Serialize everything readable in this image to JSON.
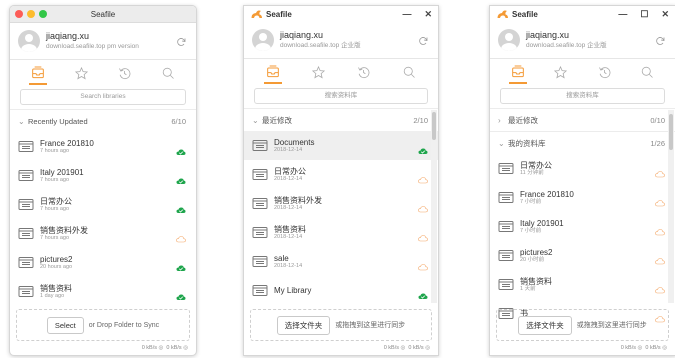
{
  "colors": {
    "accent": "#f49a35",
    "synced": "#1ea54c",
    "pending": "#f4a869"
  },
  "windows": [
    {
      "title": "Seafile",
      "user": "jiaqiang.xu",
      "server": "download.seafile.top",
      "server_suffix": "pm version",
      "search_placeholder": "Search libraries",
      "sections": [
        {
          "label": "Recently Updated",
          "count": "6/10",
          "expanded": true
        }
      ],
      "items": [
        {
          "name": "France 201810",
          "time": "7 hours ago",
          "status": "synced"
        },
        {
          "name": "Italy 201901",
          "time": "7 hours ago",
          "status": "synced"
        },
        {
          "name": "日常办公",
          "time": "7 hours ago",
          "status": "synced"
        },
        {
          "name": "销售资料外发",
          "time": "7 hours ago",
          "status": "pending"
        },
        {
          "name": "pictures2",
          "time": "20 hours ago",
          "status": "synced"
        },
        {
          "name": "销售资料",
          "time": "1 day ago",
          "status": "synced"
        }
      ],
      "footer_button": "Select",
      "footer_text": "or Drop Folder to Sync",
      "speed_up": "0 kB/s",
      "speed_down": "0 kB/s"
    },
    {
      "title": "Seafile",
      "user": "jiaqiang.xu",
      "server": "download.seafile.top",
      "server_suffix": "企业版",
      "search_placeholder": "搜索资料库",
      "sections": [
        {
          "label": "最近修改",
          "count": "2/10",
          "expanded": true
        }
      ],
      "items": [
        {
          "name": "Documents",
          "time": "2018-12-14",
          "status": "synced"
        },
        {
          "name": "日常办公",
          "time": "2018-12-14",
          "status": "pending"
        },
        {
          "name": "销售资料外发",
          "time": "2018-12-14",
          "status": "pending"
        },
        {
          "name": "销售资料",
          "time": "2018-12-14",
          "status": "pending"
        },
        {
          "name": "sale",
          "time": "2018-12-14",
          "status": "pending"
        },
        {
          "name": "My Library",
          "time": "",
          "status": "synced"
        }
      ],
      "footer_button": "选择文件夹",
      "footer_text": "或拖拽到这里进行同步",
      "speed_up": "0 kB/s",
      "speed_down": "0 kB/s"
    },
    {
      "title": "Seafile",
      "user": "jiaqiang.xu",
      "server": "download.seafile.top",
      "server_suffix": "企业版",
      "search_placeholder": "搜索资料库",
      "sections": [
        {
          "label": "最近修改",
          "count": "0/10",
          "expanded": false
        },
        {
          "label": "我的资料库",
          "count": "1/26",
          "expanded": true
        }
      ],
      "items": [
        {
          "name": "日常办公",
          "time": "11 分钟前",
          "status": "pending"
        },
        {
          "name": "France 201810",
          "time": "7 小时前",
          "status": "pending"
        },
        {
          "name": "Italy 201901",
          "time": "7 小时前",
          "status": "pending"
        },
        {
          "name": "pictures2",
          "time": "20 小时前",
          "status": "pending"
        },
        {
          "name": "销售资料",
          "time": "1 天前",
          "status": "pending"
        },
        {
          "name": "书",
          "time": "",
          "status": "pending"
        }
      ],
      "footer_button": "选择文件夹",
      "footer_text": "或拖拽到这里进行同步",
      "speed_up": "0 kB/s",
      "speed_down": "0 kB/s"
    }
  ]
}
